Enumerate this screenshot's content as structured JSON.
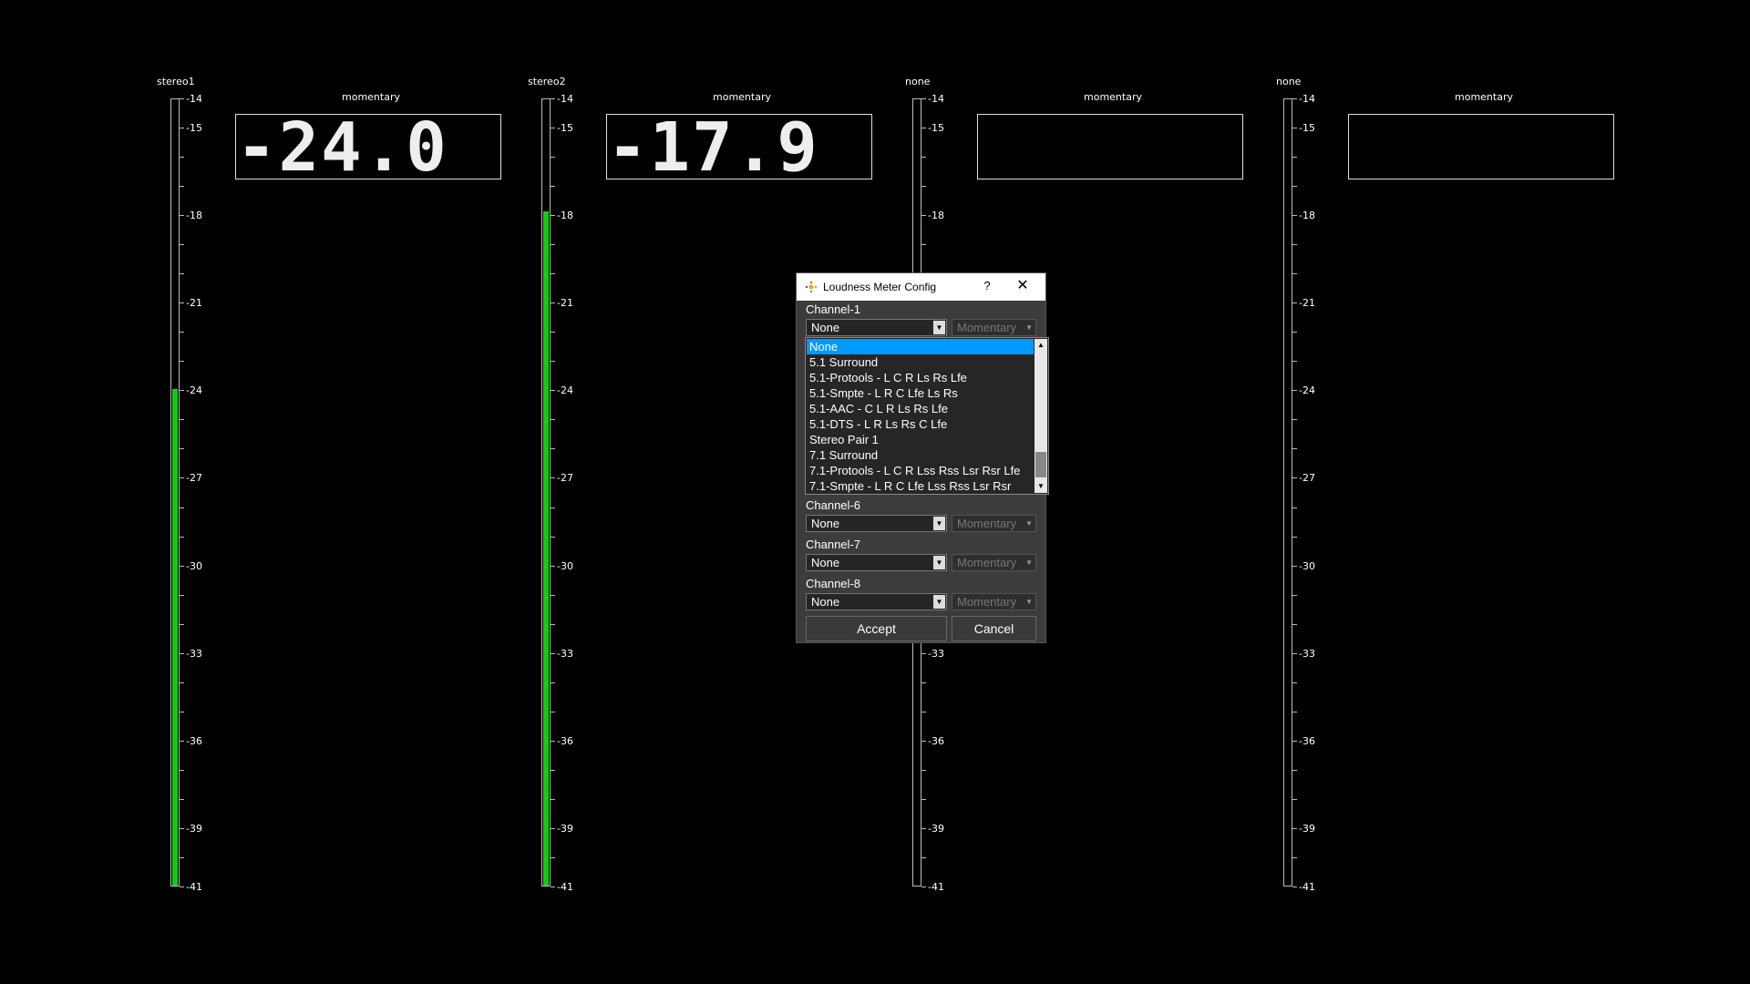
{
  "meters": [
    {
      "channel": "stereo1",
      "mode": "momentary",
      "value": "-24.0",
      "level_db": -24.0
    },
    {
      "channel": "stereo2",
      "mode": "momentary",
      "value": "-17.9",
      "level_db": -17.9
    },
    {
      "channel": "none",
      "mode": "momentary",
      "value": "",
      "level_db": null
    },
    {
      "channel": "none",
      "mode": "momentary",
      "value": "",
      "level_db": null
    }
  ],
  "scale": {
    "min_db": -41,
    "max_db": -14,
    "labels": [
      "-14",
      "-15",
      "-18",
      "-21",
      "-24",
      "-27",
      "-30",
      "-33",
      "-36",
      "-39",
      "-41"
    ],
    "fill_color": "#12cc12"
  },
  "dialog": {
    "title": "Loudness Meter Config",
    "help": "?",
    "close": "✕",
    "channels": [
      {
        "label": "Channel-1",
        "value": "None",
        "mode": "Momentary"
      },
      {
        "label": "Channel-6",
        "value": "None",
        "mode": "Momentary"
      },
      {
        "label": "Channel-7",
        "value": "None",
        "mode": "Momentary"
      },
      {
        "label": "Channel-8",
        "value": "None",
        "mode": "Momentary"
      }
    ],
    "accept_label": "Accept",
    "cancel_label": "Cancel"
  },
  "dropdown": {
    "selected": "None",
    "items": [
      "None",
      "5.1 Surround",
      "5.1-Protools - L C R Ls Rs Lfe",
      "5.1-Smpte - L R C Lfe Ls Rs",
      "5.1-AAC - C L R Ls Rs Lfe",
      "5.1-DTS -  L R Ls Rs C Lfe",
      "Stereo Pair 1",
      "7.1 Surround",
      "7.1-Protools - L C R Lss Rss Lsr Rsr Lfe",
      "7.1-Smpte - L R C Lfe Lss Rss Lsr Rsr"
    ],
    "highlight_color": "#0099ff"
  }
}
